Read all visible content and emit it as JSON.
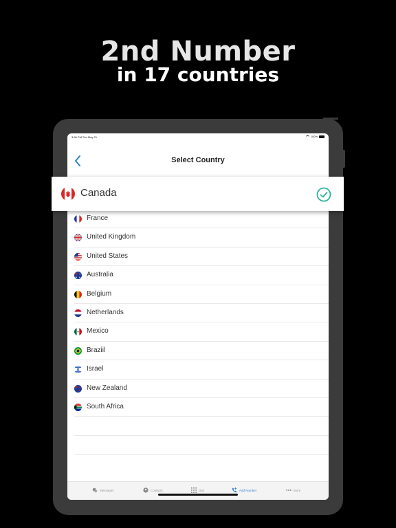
{
  "promo": {
    "title": "2nd Number",
    "subtitle": "in 17 countries"
  },
  "status_bar": {
    "time": "3:56 PM  Thu May 21",
    "battery": "100%"
  },
  "header": {
    "title": "Select Country",
    "back_icon": "chevron-left-icon"
  },
  "selected_country": {
    "name": "Canada",
    "flag": "canada-flag-icon",
    "check_icon": "check-circle-icon",
    "accent_color": "#2bb39a"
  },
  "countries": [
    {
      "name": "France",
      "flag": "france-flag-icon"
    },
    {
      "name": "United Kingdom",
      "flag": "uk-flag-icon"
    },
    {
      "name": "United States",
      "flag": "us-flag-icon"
    },
    {
      "name": "Australia",
      "flag": "australia-flag-icon"
    },
    {
      "name": "Belgium",
      "flag": "belgium-flag-icon"
    },
    {
      "name": "Netherlands",
      "flag": "netherlands-flag-icon"
    },
    {
      "name": "Mexico",
      "flag": "mexico-flag-icon"
    },
    {
      "name": "Braziil",
      "flag": "brazil-flag-icon"
    },
    {
      "name": "Israel",
      "flag": "israel-flag-icon"
    },
    {
      "name": "New Zealand",
      "flag": "new-zealand-flag-icon"
    },
    {
      "name": "South Africa",
      "flag": "south-africa-flag-icon"
    }
  ],
  "tabs": [
    {
      "label": "Messages",
      "icon": "messages-icon",
      "active": false
    },
    {
      "label": "Contacts",
      "icon": "contacts-icon",
      "active": false
    },
    {
      "label": "Dial",
      "icon": "dialpad-icon",
      "active": false
    },
    {
      "label": "Add Number",
      "icon": "add-number-icon",
      "active": true
    },
    {
      "label": "More",
      "icon": "more-icon",
      "active": false
    }
  ],
  "colors": {
    "background": "#000000",
    "device": "#3b3b3b",
    "tab_active": "#2f7fd3",
    "back_chevron": "#2f7fd3"
  }
}
